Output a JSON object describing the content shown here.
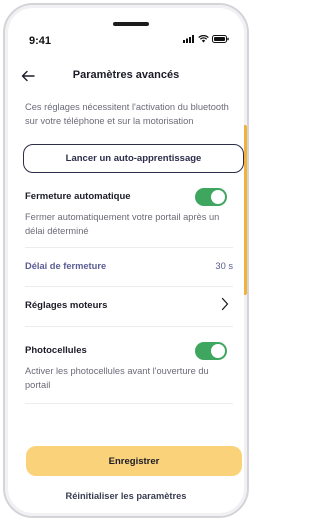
{
  "status_bar": {
    "time": "9:41",
    "icons": [
      "signal-icon",
      "wifi-icon",
      "battery-icon"
    ]
  },
  "header": {
    "title": "Paramètres avancés",
    "back_icon": "arrow-left-icon"
  },
  "info_text": "Ces réglages nécessitent l'activation du bluetooth sur votre téléphone et sur la motorisation",
  "auto_learning_button": "Lancer un auto-apprentissage",
  "auto_close": {
    "title": "Fermeture automatique",
    "description": "Fermer automatiquement votre portail après un délai déterminé",
    "enabled": true
  },
  "close_delay": {
    "label": "Délai de fermeture",
    "value": "30 s"
  },
  "motor_settings": {
    "label": "Réglages moteurs",
    "icon": "chevron-right-icon"
  },
  "photocells": {
    "title": "Photocellules",
    "description": "Activer les photocellules avant l'ouverture du portail",
    "enabled": true
  },
  "save_button": "Enregistrer",
  "reset_button": "Réinitialiser les paramètres",
  "colors": {
    "accent_yellow": "#f9d27a",
    "toggle_green": "#3fa660",
    "navy": "#2c2d4a",
    "link_purple": "#5a5c93"
  }
}
